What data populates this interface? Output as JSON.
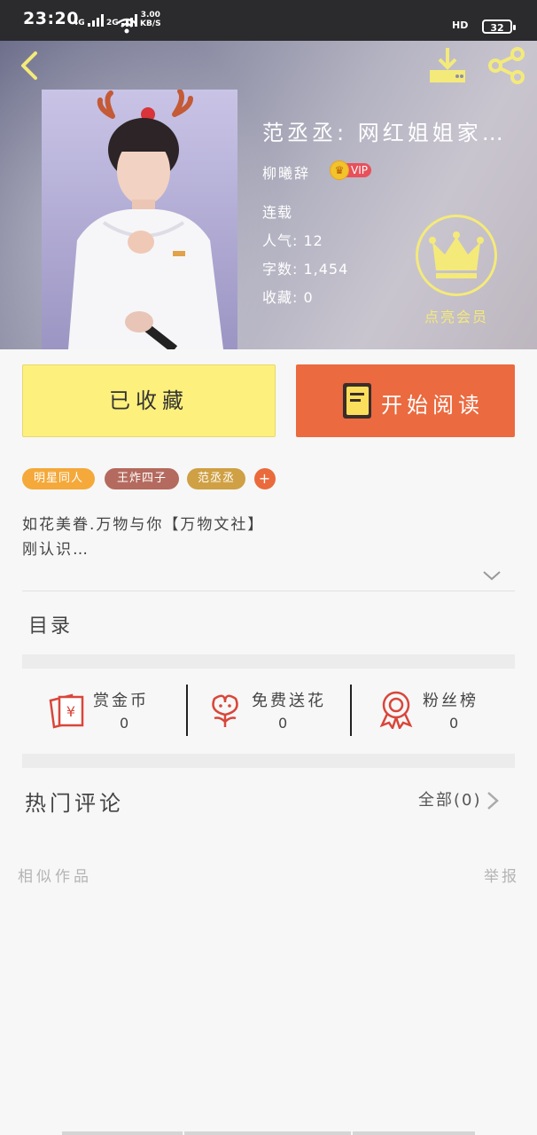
{
  "status_bar": {
    "time": "23:20",
    "network_1": "4G",
    "network_2": "2G",
    "speed_value": "3.00",
    "speed_unit": "KB/S",
    "hd": "HD",
    "battery": "32"
  },
  "header": {
    "back_icon": "chevron-left-icon",
    "download_icon": "download-icon",
    "share_icon": "share-icon"
  },
  "book": {
    "title": "范丞丞: 网红姐姐家…",
    "author": "柳曦辞",
    "vip_label": "VIP",
    "status": "连载",
    "popularity": "人气: 12",
    "word_count": "字数: 1,454",
    "favorites": "收藏: 0",
    "member_label": "点亮会员"
  },
  "actions": {
    "collected_label": "已收藏",
    "read_label": "开始阅读"
  },
  "tags": [
    {
      "label": "明星同人",
      "color": "#f4a93a"
    },
    {
      "label": "王炸四子",
      "color": "#b46a5e"
    },
    {
      "label": "范丞丞",
      "color": "#cfa044"
    },
    {
      "label": "+",
      "color": "#ea6a3c"
    }
  ],
  "description": {
    "line1": "如花美眷.万物与你【万物文社】",
    "line2": "刚认识…"
  },
  "toc_label": "目录",
  "stats": [
    {
      "label": "赏金币",
      "value": "0",
      "icon": "coin-envelope-icon"
    },
    {
      "label": "免费送花",
      "value": "0",
      "icon": "flower-icon"
    },
    {
      "label": "粉丝榜",
      "value": "0",
      "icon": "award-ribbon-icon"
    }
  ],
  "comments": {
    "title": "热门评论",
    "all_label": "全部(0)"
  },
  "footer": {
    "similar_label": "相似作品",
    "report_label": "举报"
  },
  "colors": {
    "accent_orange": "#eb6a3f",
    "collect_yellow": "#fdf07c",
    "member_yellow": "#f4ea7a",
    "icon_red": "#d9463a"
  }
}
